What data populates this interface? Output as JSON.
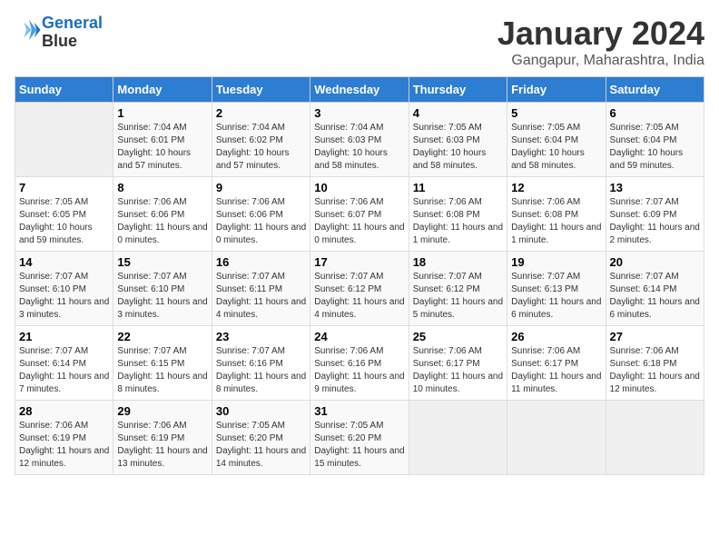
{
  "header": {
    "logo_line1": "General",
    "logo_line2": "Blue",
    "month": "January 2024",
    "location": "Gangapur, Maharashtra, India"
  },
  "weekdays": [
    "Sunday",
    "Monday",
    "Tuesday",
    "Wednesday",
    "Thursday",
    "Friday",
    "Saturday"
  ],
  "weeks": [
    [
      {
        "day": "",
        "sunrise": "",
        "sunset": "",
        "daylight": ""
      },
      {
        "day": "1",
        "sunrise": "Sunrise: 7:04 AM",
        "sunset": "Sunset: 6:01 PM",
        "daylight": "Daylight: 10 hours and 57 minutes."
      },
      {
        "day": "2",
        "sunrise": "Sunrise: 7:04 AM",
        "sunset": "Sunset: 6:02 PM",
        "daylight": "Daylight: 10 hours and 57 minutes."
      },
      {
        "day": "3",
        "sunrise": "Sunrise: 7:04 AM",
        "sunset": "Sunset: 6:03 PM",
        "daylight": "Daylight: 10 hours and 58 minutes."
      },
      {
        "day": "4",
        "sunrise": "Sunrise: 7:05 AM",
        "sunset": "Sunset: 6:03 PM",
        "daylight": "Daylight: 10 hours and 58 minutes."
      },
      {
        "day": "5",
        "sunrise": "Sunrise: 7:05 AM",
        "sunset": "Sunset: 6:04 PM",
        "daylight": "Daylight: 10 hours and 58 minutes."
      },
      {
        "day": "6",
        "sunrise": "Sunrise: 7:05 AM",
        "sunset": "Sunset: 6:04 PM",
        "daylight": "Daylight: 10 hours and 59 minutes."
      }
    ],
    [
      {
        "day": "7",
        "sunrise": "Sunrise: 7:05 AM",
        "sunset": "Sunset: 6:05 PM",
        "daylight": "Daylight: 10 hours and 59 minutes."
      },
      {
        "day": "8",
        "sunrise": "Sunrise: 7:06 AM",
        "sunset": "Sunset: 6:06 PM",
        "daylight": "Daylight: 11 hours and 0 minutes."
      },
      {
        "day": "9",
        "sunrise": "Sunrise: 7:06 AM",
        "sunset": "Sunset: 6:06 PM",
        "daylight": "Daylight: 11 hours and 0 minutes."
      },
      {
        "day": "10",
        "sunrise": "Sunrise: 7:06 AM",
        "sunset": "Sunset: 6:07 PM",
        "daylight": "Daylight: 11 hours and 0 minutes."
      },
      {
        "day": "11",
        "sunrise": "Sunrise: 7:06 AM",
        "sunset": "Sunset: 6:08 PM",
        "daylight": "Daylight: 11 hours and 1 minute."
      },
      {
        "day": "12",
        "sunrise": "Sunrise: 7:06 AM",
        "sunset": "Sunset: 6:08 PM",
        "daylight": "Daylight: 11 hours and 1 minute."
      },
      {
        "day": "13",
        "sunrise": "Sunrise: 7:07 AM",
        "sunset": "Sunset: 6:09 PM",
        "daylight": "Daylight: 11 hours and 2 minutes."
      }
    ],
    [
      {
        "day": "14",
        "sunrise": "Sunrise: 7:07 AM",
        "sunset": "Sunset: 6:10 PM",
        "daylight": "Daylight: 11 hours and 3 minutes."
      },
      {
        "day": "15",
        "sunrise": "Sunrise: 7:07 AM",
        "sunset": "Sunset: 6:10 PM",
        "daylight": "Daylight: 11 hours and 3 minutes."
      },
      {
        "day": "16",
        "sunrise": "Sunrise: 7:07 AM",
        "sunset": "Sunset: 6:11 PM",
        "daylight": "Daylight: 11 hours and 4 minutes."
      },
      {
        "day": "17",
        "sunrise": "Sunrise: 7:07 AM",
        "sunset": "Sunset: 6:12 PM",
        "daylight": "Daylight: 11 hours and 4 minutes."
      },
      {
        "day": "18",
        "sunrise": "Sunrise: 7:07 AM",
        "sunset": "Sunset: 6:12 PM",
        "daylight": "Daylight: 11 hours and 5 minutes."
      },
      {
        "day": "19",
        "sunrise": "Sunrise: 7:07 AM",
        "sunset": "Sunset: 6:13 PM",
        "daylight": "Daylight: 11 hours and 6 minutes."
      },
      {
        "day": "20",
        "sunrise": "Sunrise: 7:07 AM",
        "sunset": "Sunset: 6:14 PM",
        "daylight": "Daylight: 11 hours and 6 minutes."
      }
    ],
    [
      {
        "day": "21",
        "sunrise": "Sunrise: 7:07 AM",
        "sunset": "Sunset: 6:14 PM",
        "daylight": "Daylight: 11 hours and 7 minutes."
      },
      {
        "day": "22",
        "sunrise": "Sunrise: 7:07 AM",
        "sunset": "Sunset: 6:15 PM",
        "daylight": "Daylight: 11 hours and 8 minutes."
      },
      {
        "day": "23",
        "sunrise": "Sunrise: 7:07 AM",
        "sunset": "Sunset: 6:16 PM",
        "daylight": "Daylight: 11 hours and 8 minutes."
      },
      {
        "day": "24",
        "sunrise": "Sunrise: 7:06 AM",
        "sunset": "Sunset: 6:16 PM",
        "daylight": "Daylight: 11 hours and 9 minutes."
      },
      {
        "day": "25",
        "sunrise": "Sunrise: 7:06 AM",
        "sunset": "Sunset: 6:17 PM",
        "daylight": "Daylight: 11 hours and 10 minutes."
      },
      {
        "day": "26",
        "sunrise": "Sunrise: 7:06 AM",
        "sunset": "Sunset: 6:17 PM",
        "daylight": "Daylight: 11 hours and 11 minutes."
      },
      {
        "day": "27",
        "sunrise": "Sunrise: 7:06 AM",
        "sunset": "Sunset: 6:18 PM",
        "daylight": "Daylight: 11 hours and 12 minutes."
      }
    ],
    [
      {
        "day": "28",
        "sunrise": "Sunrise: 7:06 AM",
        "sunset": "Sunset: 6:19 PM",
        "daylight": "Daylight: 11 hours and 12 minutes."
      },
      {
        "day": "29",
        "sunrise": "Sunrise: 7:06 AM",
        "sunset": "Sunset: 6:19 PM",
        "daylight": "Daylight: 11 hours and 13 minutes."
      },
      {
        "day": "30",
        "sunrise": "Sunrise: 7:05 AM",
        "sunset": "Sunset: 6:20 PM",
        "daylight": "Daylight: 11 hours and 14 minutes."
      },
      {
        "day": "31",
        "sunrise": "Sunrise: 7:05 AM",
        "sunset": "Sunset: 6:20 PM",
        "daylight": "Daylight: 11 hours and 15 minutes."
      },
      {
        "day": "",
        "sunrise": "",
        "sunset": "",
        "daylight": ""
      },
      {
        "day": "",
        "sunrise": "",
        "sunset": "",
        "daylight": ""
      },
      {
        "day": "",
        "sunrise": "",
        "sunset": "",
        "daylight": ""
      }
    ]
  ]
}
